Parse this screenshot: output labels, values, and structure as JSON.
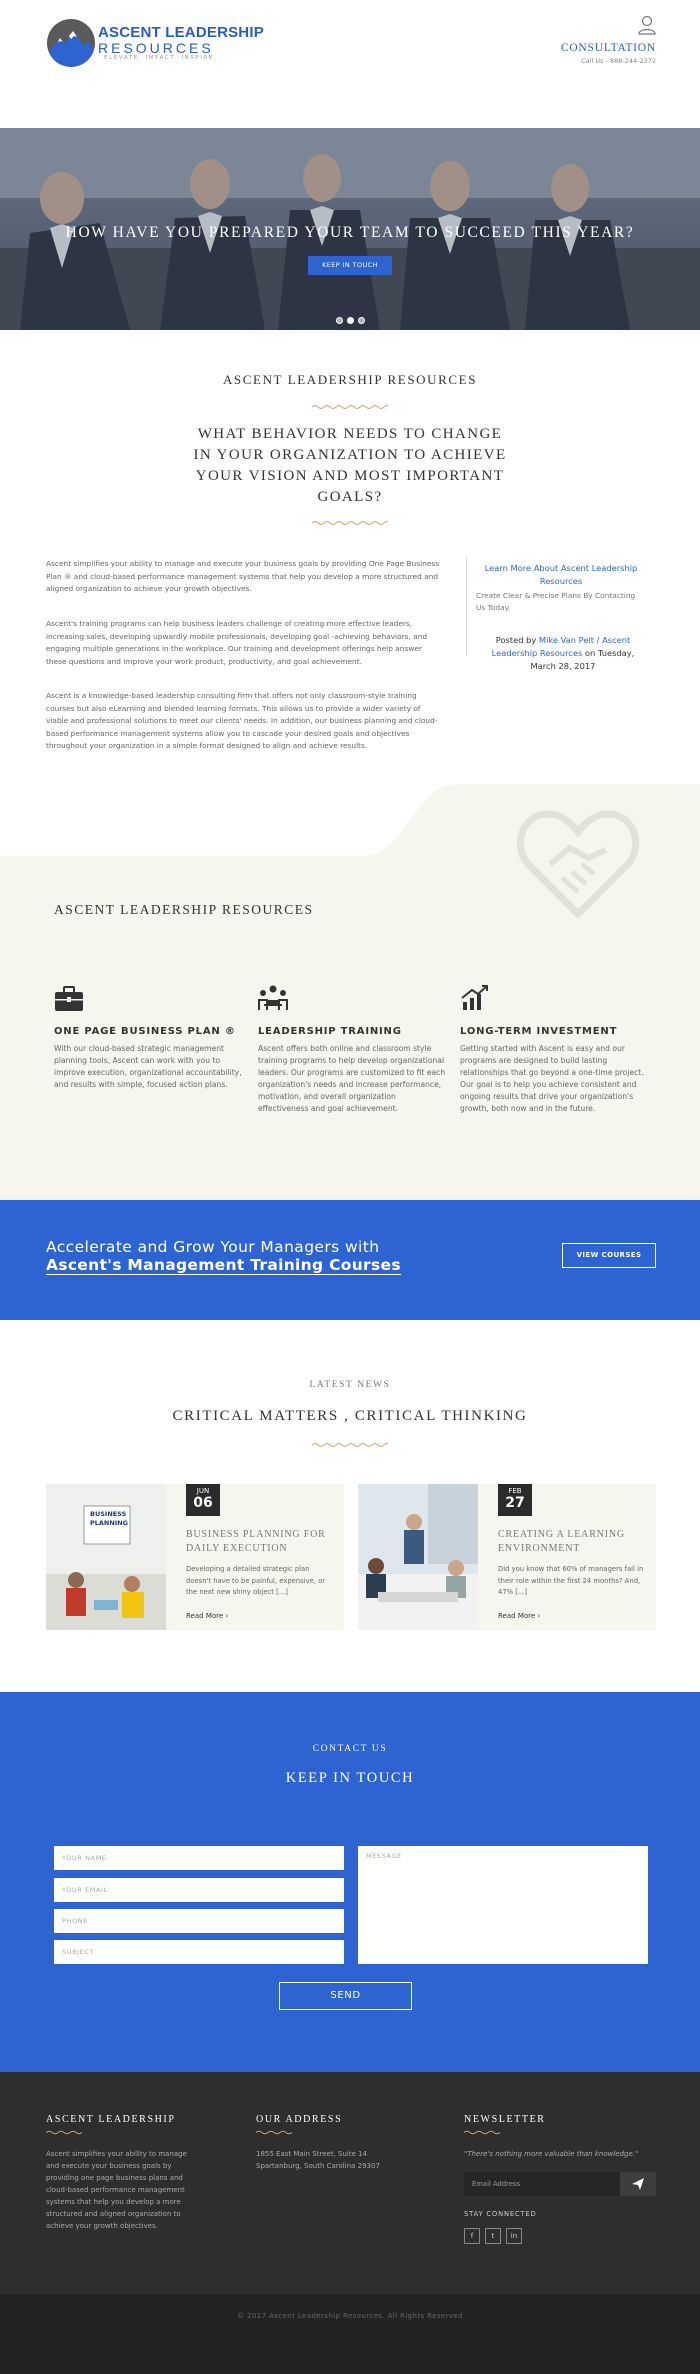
{
  "brand": {
    "name_line1": "ASCENT LEADERSHIP",
    "name_line2": "RESOURCES",
    "tagline": "ELEVATE. IMPACT. INSPIRE",
    "accent": "#2d64d2"
  },
  "header": {
    "consultation": "CONSULTATION",
    "call": "Call Us - 888-244-2372"
  },
  "hero": {
    "title": "HOW HAVE YOU PREPARED YOUR TEAM TO SUCCEED THIS YEAR?",
    "button": "KEEP IN TOUCH"
  },
  "intro": {
    "heading": "ASCENT LEADERSHIP RESOURCES",
    "question_l1": "WHAT BEHAVIOR NEEDS TO CHANGE",
    "question_l2": "IN YOUR ORGANIZATION TO ACHIEVE",
    "question_l3": "YOUR VISION AND MOST IMPORTANT",
    "question_l4": "GOALS?",
    "p1": "Ascent simplifies your ability to manage and execute your business goals by providing One Page Business Plan ® and cloud-based performance management systems that help you develop a more structured and aligned organization to achieve your growth objectives.",
    "p2": "Ascent's training programs can help business leaders challenge of creating more effective leaders, increasing sales, developing upwardly mobile professionals, developing goal -achieving behaviors, and engaging multiple generations in the workplace. Our training and development offerings help answer these questions and improve your work product, productivity, and goal achievement.",
    "p3": "Ascent is a knowledge-based leadership consulting firm that offers not only classroom-style training courses but also eLearning and blended learning formats. This allows us to provide a wider variety of viable and professional solutions to meet our clients' needs. In addition, our business planning and cloud-based performance management systems allow you to cascade your desired goals and objectives throughout your organization in a simple format designed to align and achieve results."
  },
  "aside": {
    "link": "Learn More About Ascent Leadership Resources",
    "sub": "Create Clear & Precise Plans By Contacting Us Today.",
    "posted_by": "Posted by",
    "author": "Mike Van Pelt / Ascent Leadership Resources",
    "on": "on",
    "date": "Tuesday, March 28, 2017"
  },
  "features": {
    "heading": "ASCENT LEADERSHIP RESOURCES",
    "items": [
      {
        "title": "ONE PAGE BUSINESS PLAN ®",
        "text": "With our cloud-based strategic management planning tools, Ascent can work with you to improve execution, organizational accountability, and results with simple, focused action plans.",
        "icon": "briefcase-icon"
      },
      {
        "title": "LEADERSHIP TRAINING",
        "text": "Ascent offers both online and classroom style training programs to help develop organizational leaders. Our programs are customized to fit each organization's needs and increase performance, motivation, and overall organization effectiveness and goal achievement.",
        "icon": "team-icon"
      },
      {
        "title": "LONG-TERM INVESTMENT",
        "text": "Getting started with Ascent is easy and our programs are designed to build lasting relationships that go beyond a one-time project. Our goal is to help you achieve consistent and ongoing results that drive your organization's growth, both now and in the future.",
        "icon": "growth-chart-icon"
      }
    ]
  },
  "cta": {
    "line1": "Accelerate and Grow Your Managers with",
    "line2": "Ascent's Management Training Courses",
    "button": "VIEW COURSES"
  },
  "news": {
    "kicker": "LATEST NEWS",
    "heading": "CRITICAL MATTERS , CRITICAL THINKING",
    "cards": [
      {
        "month": "JUN",
        "day": "06",
        "title_l1": "BUSINESS PLANNING FOR",
        "title_l2": "DAILY EXECUTION",
        "excerpt": "Developing a detailed strategic plan doesn't have to be painful, expensive, or the next new shiny object [...]",
        "more": "Read More ›",
        "img_label_l1": "BUSINESS",
        "img_label_l2": "PLANNING"
      },
      {
        "month": "FEB",
        "day": "27",
        "title_l1": "CREATING A LEARNING",
        "title_l2": "ENVIRONMENT",
        "excerpt": "Did you know that 60% of managers fail in their role within the first 24 months? And, 47% [...]",
        "more": "Read More ›"
      }
    ]
  },
  "contact": {
    "kicker": "CONTACT US",
    "heading": "KEEP IN TOUCH",
    "name_ph": "YOUR NAME",
    "email_ph": "YOUR EMAIL",
    "phone_ph": "PHONE",
    "subject_ph": "SUBJECT",
    "message_ph": "MESSAGE",
    "send": "SEND"
  },
  "footer": {
    "col1_title": "ASCENT LEADERSHIP",
    "col1_text": "Ascent simplifies your ability to manage and execute your business goals by providing one page business plans and cloud-based performance management systems that help you develop a more structured and aligned organization to achieve your growth objectives.",
    "col2_title": "OUR ADDRESS",
    "address_l1": "1855 East Main Street, Suite 14",
    "address_l2": "Spartanburg, South Carolina 29307",
    "col3_title": "NEWSLETTER",
    "quote": "\"There's nothing more valuable than knowledge.\"",
    "email_ph": "Email Address",
    "stay": "STAY CONNECTED",
    "social": [
      "f",
      "t",
      "in"
    ],
    "copyright": "© 2017 Ascent Leadership Resources. All Rights Reserved"
  }
}
